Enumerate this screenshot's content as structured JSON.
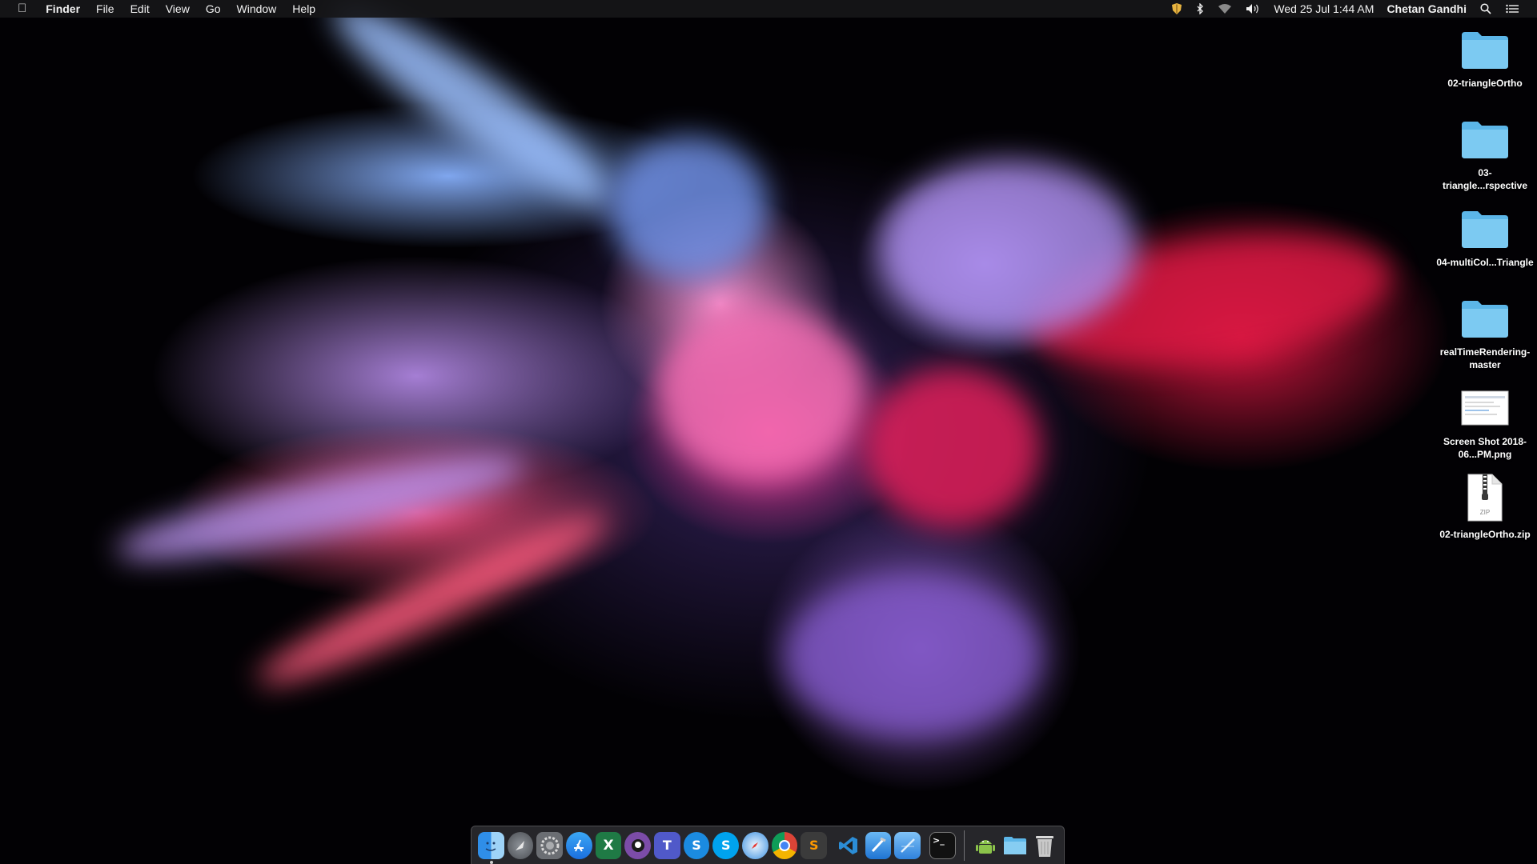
{
  "menubar": {
    "app_name": "Finder",
    "menus": [
      "File",
      "Edit",
      "View",
      "Go",
      "Window",
      "Help"
    ],
    "datetime": "Wed 25 Jul  1:44 AM",
    "user": "Chetan Gandhi",
    "status_icons": [
      "shield-icon",
      "bluetooth-icon",
      "wifi-icon",
      "volume-icon",
      "search-icon",
      "list-icon"
    ]
  },
  "desktop_icons": [
    {
      "type": "folder",
      "label": "02-triangleOrtho"
    },
    {
      "type": "folder",
      "label": "03-triangle...rspective"
    },
    {
      "type": "folder",
      "label": "04-multiCol...Triangle"
    },
    {
      "type": "folder",
      "label": "realTimeRendering-master"
    },
    {
      "type": "image",
      "label": "Screen Shot 2018-06...PM.png"
    },
    {
      "type": "zip",
      "label": "02-triangleOrtho.zip",
      "badge": "ZIP"
    }
  ],
  "dock": {
    "apps": [
      {
        "name": "finder-icon",
        "running": true
      },
      {
        "name": "launchpad-icon"
      },
      {
        "name": "system-preferences-icon"
      },
      {
        "name": "app-store-icon"
      },
      {
        "name": "excel-icon",
        "glyph": "X"
      },
      {
        "name": "github-desktop-icon"
      },
      {
        "name": "teams-icon",
        "glyph": "T"
      },
      {
        "name": "skype-icon",
        "glyph": "S"
      },
      {
        "name": "skype-for-business-icon",
        "glyph": "S"
      },
      {
        "name": "safari-icon"
      },
      {
        "name": "chrome-icon"
      },
      {
        "name": "sublime-text-icon",
        "glyph": "S"
      },
      {
        "name": "vscode-icon"
      },
      {
        "name": "xcode-icon"
      },
      {
        "name": "instruments-icon"
      },
      {
        "name": "terminal-icon",
        "glyph": ">_"
      },
      {
        "name": "android-studio-icon"
      },
      {
        "name": "downloads-folder-icon"
      },
      {
        "name": "trash-icon"
      }
    ]
  }
}
